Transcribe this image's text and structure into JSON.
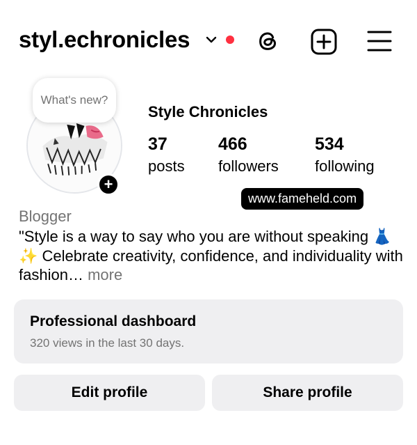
{
  "header": {
    "username": "styl.echronicles",
    "notification_color": "#ff3040",
    "icons": [
      "chevron-down-icon",
      "threads-icon",
      "new-post-icon",
      "menu-icon"
    ]
  },
  "profile": {
    "note_text": "What's new?",
    "display_name": "Style Chronicles",
    "stats": {
      "posts": {
        "count": "37",
        "label": "posts"
      },
      "followers": {
        "count": "466",
        "label": "followers"
      },
      "following": {
        "count": "534",
        "label": "following"
      }
    },
    "watermark": "www.fameheld.com",
    "category": "Blogger",
    "bio_text": "\"Style is a way to say who you are without speaking 👗✨ Celebrate creativity, confidence, and individuality with fashion…",
    "bio_more": "more"
  },
  "dashboard": {
    "title": "Professional dashboard",
    "subtitle": "320 views in the last 30 days."
  },
  "actions": {
    "edit_label": "Edit profile",
    "share_label": "Share profile"
  },
  "colors": {
    "accent_red": "#ff3040",
    "secondary_text": "#737373",
    "card_background": "#efeff1"
  }
}
